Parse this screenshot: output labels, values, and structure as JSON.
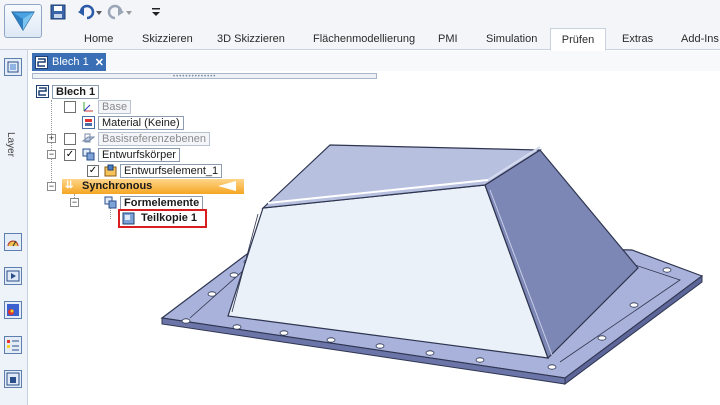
{
  "quick_access": {
    "app_icon": "solid-edge-app-icon",
    "save_icon": "save-icon",
    "undo_icon": "undo-icon",
    "redo_icon": "redo-icon",
    "customize_icon": "customize-dropdown-icon"
  },
  "ribbon": {
    "tabs": [
      "Home",
      "Skizzieren",
      "3D Skizzieren",
      "Flächenmodellierung",
      "PMI",
      "Simulation",
      "Prüfen",
      "Extras",
      "Add-Ins"
    ],
    "active_tab": "Prüfen"
  },
  "left_strip": {
    "layer_label": "Layer"
  },
  "document_tab": {
    "label": "Blech 1",
    "close": "✕"
  },
  "tree": {
    "root": "Blech 1",
    "base": "Base",
    "material": "Material (Keine)",
    "ref_planes": "Basisreferenzebenen",
    "design_bodies": "Entwurfskörper",
    "design_element": "Entwurfselement_1",
    "synchronous": "Synchronous",
    "features": "Formelemente",
    "part_copy": "Teilkopie 1"
  },
  "colors": {
    "highlight_border": "#d81e1e",
    "synchronous_bar": "#f5a623",
    "doc_tab": "#3a6fb5"
  }
}
